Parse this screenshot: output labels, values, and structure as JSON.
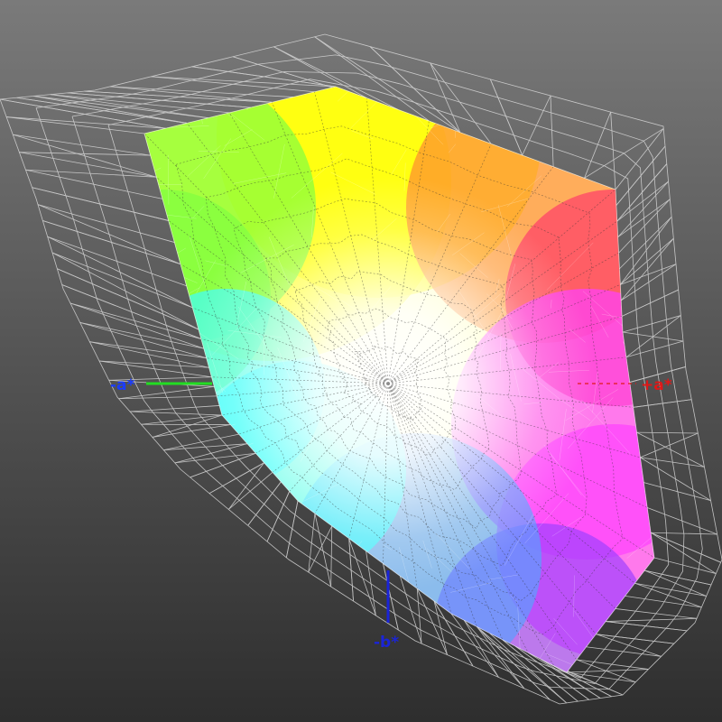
{
  "background": {
    "top_color": "#7a7a7a",
    "bottom_color": "#2e2e2e"
  },
  "axes": {
    "neg_a": {
      "label": "-a*",
      "color": "#1a3cff",
      "line_color": "#22dd22"
    },
    "pos_a": {
      "label": "+a*",
      "color": "#e01818"
    },
    "neg_b": {
      "label": "-b*",
      "color": "#1a24d8"
    }
  },
  "gamut": {
    "surface_colors": {
      "yellow": "#ffff00",
      "green": "#80ff40",
      "orange": "#ff8a30",
      "red": "#ff3c6a",
      "magenta": "#ff40ff",
      "purple": "#a040ff",
      "blue": "#5aa0ff",
      "cyan": "#40ffff",
      "white": "#ffffff"
    },
    "mesh_color": "#d8d8d8"
  }
}
